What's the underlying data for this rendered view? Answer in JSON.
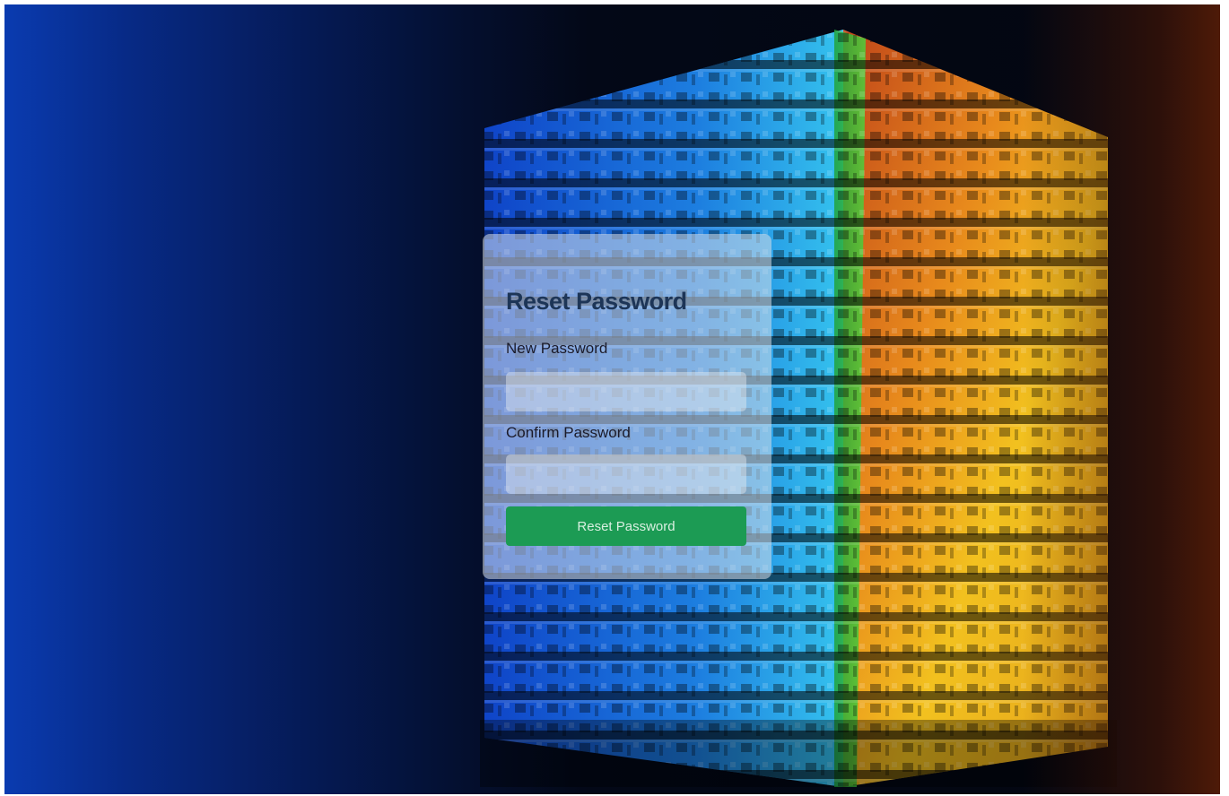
{
  "form": {
    "title": "Reset Password",
    "new_password_label": "New Password",
    "new_password_value": "",
    "confirm_password_label": "Confirm Password",
    "confirm_password_value": "",
    "submit_label": "Reset Password"
  },
  "colors": {
    "button": "#1c9b54",
    "title": "#1d3557"
  }
}
